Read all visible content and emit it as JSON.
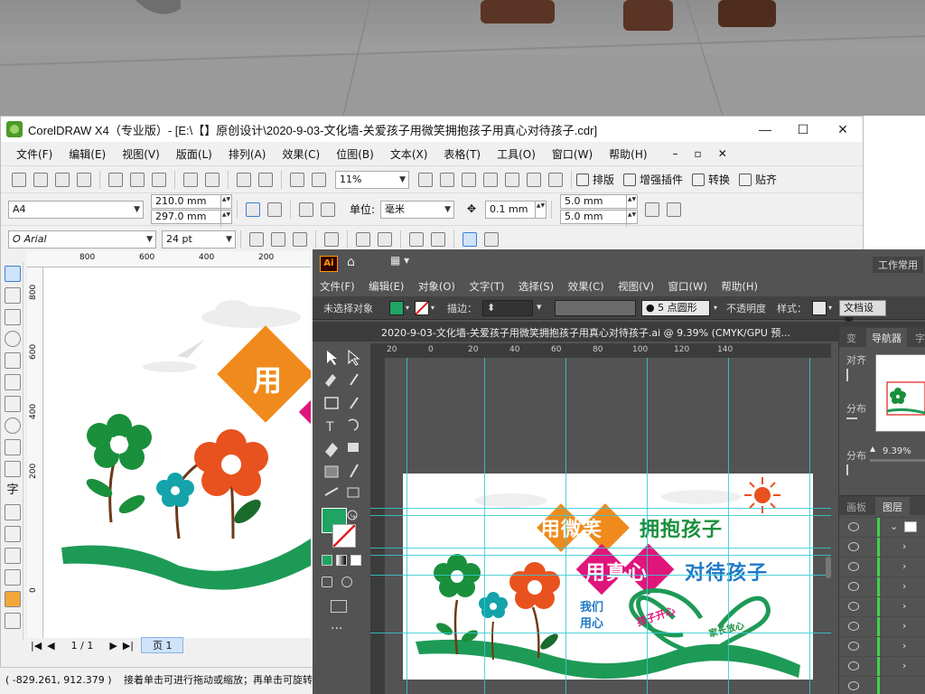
{
  "corel": {
    "title": "CorelDRAW X4（专业版）- [E:\\【】原创设计\\2020-9-03-文化墙-关爱孩子用微笑拥抱孩子用真心对待孩子.cdr]",
    "window_controls": [
      "—",
      "☐",
      "✕"
    ],
    "inner_controls": [
      "–",
      "▫",
      "✕"
    ],
    "menu": [
      "文件(F)",
      "编辑(E)",
      "视图(V)",
      "版面(L)",
      "排列(A)",
      "效果(C)",
      "位图(B)",
      "文本(X)",
      "表格(T)",
      "工具(O)",
      "窗口(W)",
      "帮助(H)"
    ],
    "zoom": "11%",
    "toolbar_buttons": [
      "排版",
      "增强插件",
      "转换",
      "贴齐"
    ],
    "paper": "A4",
    "width": "210.0 mm",
    "height": "297.0 mm",
    "unit_label": "单位:",
    "unit": "毫米",
    "nudge": "0.1 mm",
    "dup_x": "5.0 mm",
    "dup_y": "5.0 mm",
    "font": "Arial",
    "font_size": "24 pt",
    "ruler_h": [
      "800",
      "600",
      "400",
      "200"
    ],
    "ruler_v": [
      "800",
      "600",
      "400",
      "200",
      "0"
    ],
    "page_count": "1 / 1",
    "page_tab": "页 1",
    "status_coords": "( -829.261, 912.379 )",
    "status_text": "接着单击可进行拖动或缩放；再单击可旋转或倾"
  },
  "ai": {
    "logo": "Ai",
    "workspace": "工作常用",
    "menu": [
      "文件(F)",
      "编辑(E)",
      "对象(O)",
      "文字(T)",
      "选择(S)",
      "效果(C)",
      "视图(V)",
      "窗口(W)",
      "帮助(H)"
    ],
    "no_selection": "未选择对象",
    "stroke_label": "描边：",
    "brush": "5 点圆形",
    "opacity_label": "不透明度",
    "style_label": "样式：",
    "doc_settings": "文档设置",
    "doc_tab": "2020-9-03-文化墙-关爱孩子用微笑拥抱孩子用真心对待孩子.ai @ 9.39% (CMYK/GPU 预...",
    "ruler": [
      "20",
      "0",
      "20",
      "40",
      "60",
      "80",
      "100",
      "120",
      "140"
    ],
    "panel_tabs": [
      "变",
      "导航器",
      "字"
    ],
    "panel_side": [
      "对齐",
      "分布",
      "分布"
    ],
    "nav_zoom": "9.39%",
    "lower_tabs": [
      "画板",
      "图层"
    ]
  },
  "artwork": {
    "line1a": "用微笑",
    "line1b": "拥抱孩子",
    "line2a": "用真心",
    "line2b": "对待孩子",
    "left_text": [
      "我们",
      "用心"
    ],
    "heart1": "孩子开心",
    "heart2": "家长放心",
    "corel_char": "用",
    "colors": {
      "orange": "#f08a1c",
      "magenta": "#e0157c",
      "green": "#1a8f3c",
      "blue": "#2079c7",
      "red": "#e8521e",
      "teal": "#13a3a8"
    }
  }
}
